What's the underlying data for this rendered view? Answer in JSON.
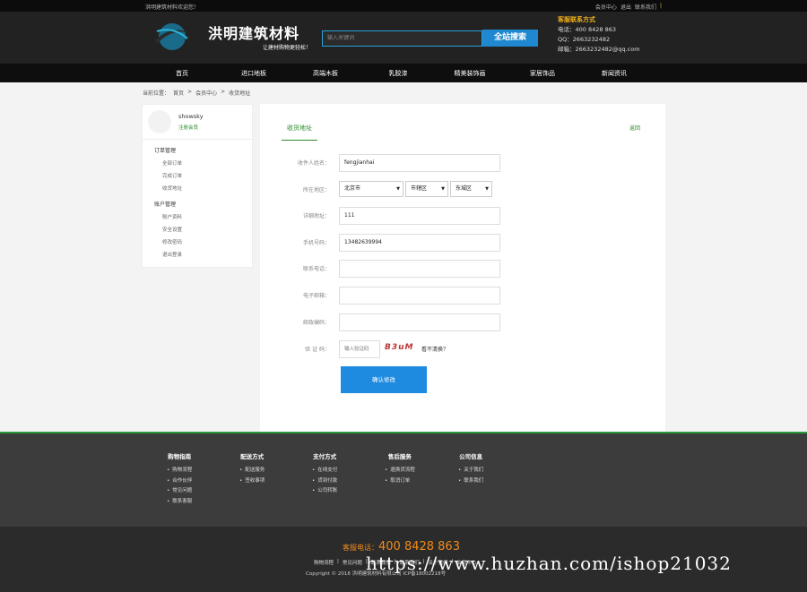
{
  "topbar": {
    "welcome": "洪明建筑材料欢迎您！",
    "links": [
      "会员中心",
      "退出",
      "联系我们",
      "|"
    ]
  },
  "header": {
    "brand": "洪明建筑材料",
    "slogan": "让建材购物更轻松！",
    "search_placeholder": "输入关键词",
    "search_button": "全站搜索",
    "contact_title": "客服联系方式",
    "tel": "电话：400 8428 863",
    "qq": "QQ：2663232482",
    "email": "邮箱：2663232482@qq.com"
  },
  "nav": [
    "首页",
    "进口地板",
    "高端木板",
    "乳胶漆",
    "精美装饰画",
    "家居饰品",
    "新闻资讯"
  ],
  "breadcrumb": [
    "当前位置：",
    "首页",
    ">",
    "会员中心",
    ">",
    "收货地址"
  ],
  "sidebar": {
    "username": "showsky",
    "level": "注册会员",
    "groups": [
      {
        "title": "订单管理",
        "items": [
          "全部订单",
          "完成订单",
          "收货地址"
        ]
      },
      {
        "title": "账户管理",
        "items": [
          "账户资料",
          "安全设置",
          "修改密码",
          "退出登录"
        ]
      }
    ]
  },
  "form": {
    "tab": "收货地址",
    "back": "返回",
    "fields": [
      {
        "label": "收件人姓名：",
        "value": "fengjianhai"
      },
      {
        "label": "所在地区：",
        "value": ""
      },
      {
        "label": "详细地址：",
        "value": "111"
      },
      {
        "label": "手机号码：",
        "value": "13482639994"
      },
      {
        "label": "联系电话：",
        "value": ""
      },
      {
        "label": "电子邮箱：",
        "value": ""
      },
      {
        "label": "邮政编码：",
        "value": ""
      }
    ],
    "region": [
      "北京市",
      "市辖区",
      "东城区"
    ],
    "captcha_label": "验 证 码：",
    "captcha_placeholder": "输入验证码",
    "captcha_text": "B3uM",
    "captcha_tip": "看不清换？",
    "submit": "确认修改"
  },
  "footer": {
    "columns": [
      {
        "title": "购物指南",
        "items": [
          "购物流程",
          "合作伙伴",
          "常见问题",
          "联系客服"
        ]
      },
      {
        "title": "配送方式",
        "items": [
          "配送服务",
          "签收事项"
        ]
      },
      {
        "title": "支付方式",
        "items": [
          "在线支付",
          "货到付款",
          "公司转账"
        ]
      },
      {
        "title": "售后服务",
        "items": [
          "退换货流程",
          "取消订单"
        ]
      },
      {
        "title": "公司信息",
        "items": [
          "关于我们",
          "联系我们"
        ]
      }
    ],
    "hotline_label": "客服电话：",
    "hotline": "400 8428 863",
    "links": [
      "购物流程",
      "|",
      "常见问题",
      "|",
      "联系我们",
      "|",
      "联系我们",
      "|",
      "关于我们",
      "|",
      "会员中心"
    ],
    "copyright": "Copyright © 2018 洪明建筑材料有限公司 ICP备18002218号"
  },
  "watermark": "https://www.huzhan.com/ishop21032"
}
